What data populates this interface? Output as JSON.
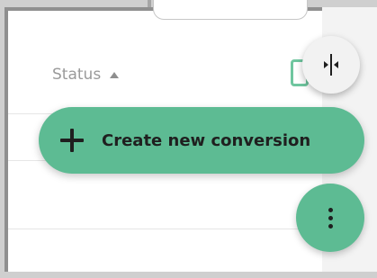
{
  "table": {
    "status_header": "Status"
  },
  "actions": {
    "create_label": "Create new conversion"
  },
  "icons": {
    "sort": "sort-ascending-icon",
    "split": "split-view-icon",
    "add": "plus-icon",
    "more": "more-vertical-icon"
  },
  "colors": {
    "accent": "#5dbb93",
    "ink": "#1f1f1f"
  }
}
